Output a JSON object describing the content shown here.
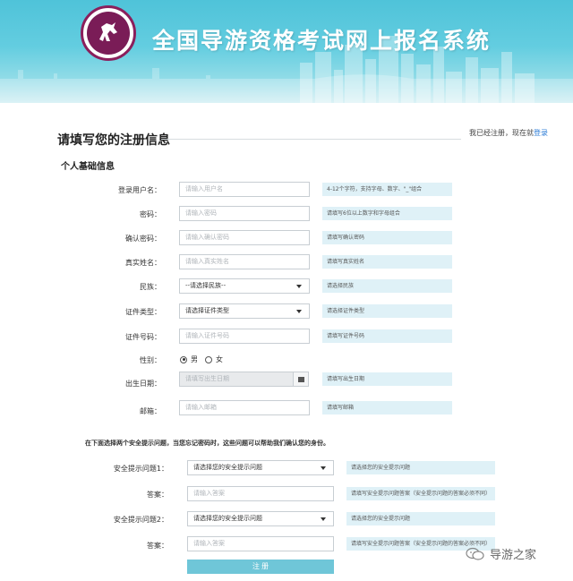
{
  "header": {
    "title": "全国导游资格考试网上报名系统",
    "colors": {
      "banner": "#4fc3d9",
      "logo": "#7a1c57"
    }
  },
  "page": {
    "title": "请填写您的注册信息",
    "login_hint_prefix": "我已经注册，现在就",
    "login_link": "登录",
    "section_basic": "个人基础信息",
    "security_note": "在下面选择两个安全提示问题，当您忘记密码时，这些问题可以帮助我们确认您的身份。",
    "submit_label": "注 册"
  },
  "form": {
    "username": {
      "label": "登录用户名：",
      "placeholder": "请输入用户名",
      "hint": "4-12个字符，支持字母、数字、\"_\"组合"
    },
    "password": {
      "label": "密码：",
      "placeholder": "请输入密码",
      "hint": "请填写6位以上数字和字母组合"
    },
    "confirm_password": {
      "label": "确认密码：",
      "placeholder": "请输入确认密码",
      "hint": "请填写确认密码"
    },
    "real_name": {
      "label": "真实姓名：",
      "placeholder": "请输入真实姓名",
      "hint": "请填写真实姓名"
    },
    "ethnicity": {
      "label": "民族：",
      "value": "--请选择民族--",
      "hint": "请选择民族"
    },
    "id_type": {
      "label": "证件类型：",
      "value": "请选择证件类型",
      "hint": "请选择证件类型"
    },
    "id_number": {
      "label": "证件号码：",
      "placeholder": "请输入证件号码",
      "hint": "请填写证件号码"
    },
    "gender": {
      "label": "性别：",
      "male": "男",
      "female": "女",
      "selected": "男"
    },
    "birth_date": {
      "label": "出生日期：",
      "placeholder": "请填写出生日期",
      "hint": "请填写出生日期"
    },
    "email": {
      "label": "邮箱：",
      "placeholder": "请输入邮箱",
      "hint": "请填写邮箱"
    },
    "question1": {
      "label": "安全提示问题1：",
      "value": "请选择您的安全提示问题",
      "hint": "请选择您的安全提示问题"
    },
    "answer1": {
      "label": "答案：",
      "placeholder": "请输入答案",
      "hint": "请填写安全提示问题答案（安全提示问题的答案必须不同）"
    },
    "question2": {
      "label": "安全提示问题2：",
      "value": "请选择您的安全提示问题",
      "hint": "请选择您的安全提示问题"
    },
    "answer2": {
      "label": "答案：",
      "placeholder": "请输入答案",
      "hint": "请填写安全提示问题答案（安全提示问题的答案必须不同）"
    }
  },
  "watermark": {
    "text": "导游之家"
  }
}
